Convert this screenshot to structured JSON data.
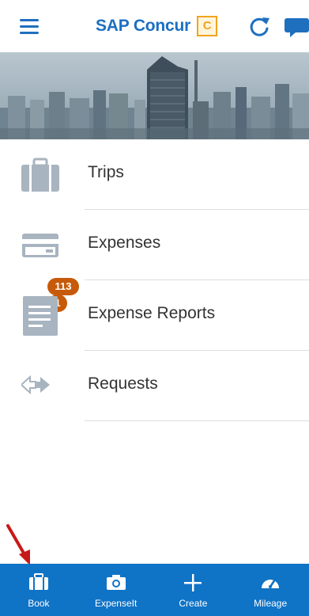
{
  "header": {
    "brand_text": "SAP Concur",
    "brand_logo_letter": "C",
    "brand_color": "#1a6fc2",
    "logo_color": "#f0a41c"
  },
  "menu": {
    "items": [
      {
        "label": "Trips",
        "icon": "suitcase-icon"
      },
      {
        "label": "Expenses",
        "icon": "credit-card-icon",
        "badge": "1"
      },
      {
        "label": "Expense Reports",
        "icon": "document-icon",
        "badge": "113"
      },
      {
        "label": "Requests",
        "icon": "arrows-exchange-icon"
      }
    ]
  },
  "tabbar": {
    "bg_color": "#0f73c6",
    "tabs": [
      {
        "label": "Book",
        "icon": "briefcase-icon"
      },
      {
        "label": "ExpenseIt",
        "icon": "camera-icon"
      },
      {
        "label": "Create",
        "icon": "plus-icon"
      },
      {
        "label": "Mileage",
        "icon": "speedometer-icon"
      }
    ]
  },
  "badge_color": "#c65a0a"
}
